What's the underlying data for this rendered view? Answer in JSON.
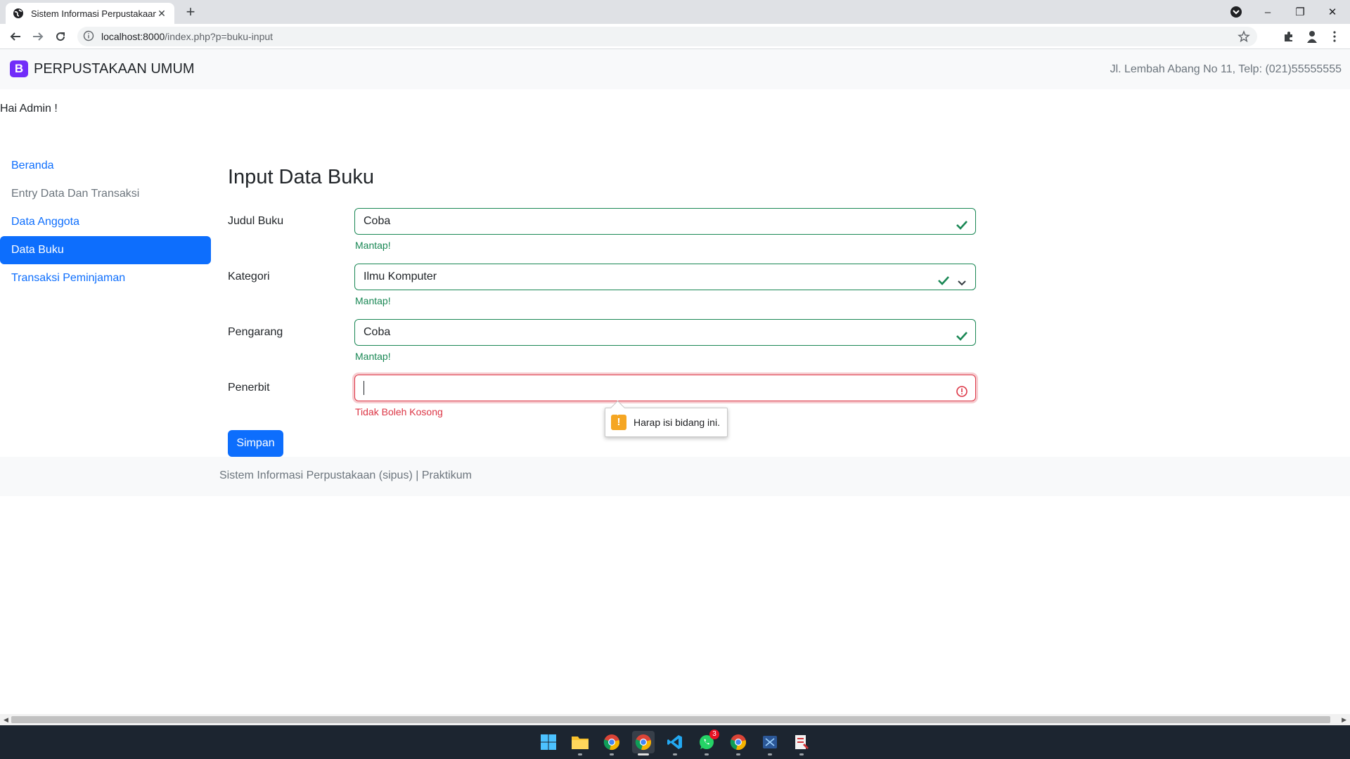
{
  "browser": {
    "tab_title": "Sistem Informasi Perpustakaan",
    "new_tab": "+",
    "url_host": "localhost:8000",
    "url_path": "/index.php?p=buku-input",
    "window_controls": {
      "minimize": "–",
      "restore": "❐",
      "close": "✕"
    }
  },
  "navbar": {
    "brand_logo": "B",
    "brand_text": "PERPUSTAKAAN UMUM",
    "address": "Jl. Lembah Abang No 11, Telp: (021)55555555"
  },
  "greeting": "Hai Admin !",
  "sidebar": {
    "items": [
      {
        "label": "Beranda",
        "state": "link"
      },
      {
        "label": "Entry Data Dan Transaksi",
        "state": "muted"
      },
      {
        "label": "Data Anggota",
        "state": "link"
      },
      {
        "label": "Data Buku",
        "state": "active"
      },
      {
        "label": "Transaksi Peminjaman",
        "state": "link"
      }
    ]
  },
  "form": {
    "title": "Input Data Buku",
    "fields": [
      {
        "label": "Judul Buku",
        "value": "Coba",
        "feedback": "Mantap!",
        "valid": true
      },
      {
        "label": "Kategori",
        "value": "Ilmu Komputer",
        "feedback": "Mantap!",
        "valid": true
      },
      {
        "label": "Pengarang",
        "value": "Coba",
        "feedback": "Mantap!",
        "valid": true
      },
      {
        "label": "Penerbit",
        "value": "",
        "feedback": "Tidak Boleh Kosong",
        "valid": false
      }
    ],
    "tooltip": "Harap isi bidang ini.",
    "submit_label": "Simpan"
  },
  "footer": {
    "text": "Sistem Informasi Perpustakaan (sipus) | Praktikum"
  },
  "taskbar": {
    "whatsapp_badge": "3"
  },
  "colors": {
    "primary": "#0d6efd",
    "valid": "#198754",
    "invalid": "#dc3545",
    "brand": "#712cf9"
  }
}
